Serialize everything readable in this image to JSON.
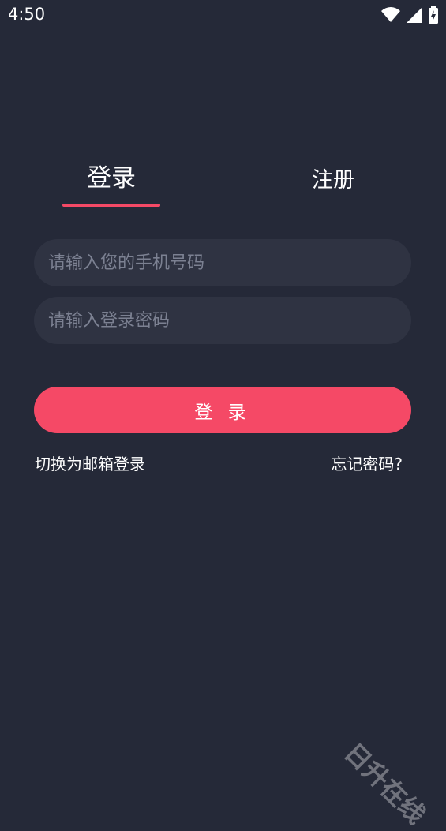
{
  "status_bar": {
    "time": "4:50"
  },
  "tabs": {
    "login": "登录",
    "register": "注册"
  },
  "form": {
    "phone_placeholder": "请输入您的手机号码",
    "password_placeholder": "请输入登录密码",
    "submit_label": "登 录"
  },
  "links": {
    "switch_email": "切换为邮箱登录",
    "forgot_password": "忘记密码?"
  },
  "watermark": "日升在线",
  "colors": {
    "background": "#252938",
    "accent": "#f54966",
    "field": "#2f3342"
  },
  "icons": [
    "wifi-icon",
    "signal-icon",
    "battery-charging-icon"
  ]
}
